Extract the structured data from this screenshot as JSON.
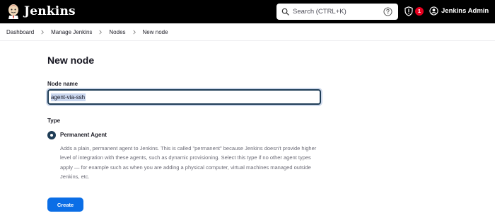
{
  "header": {
    "brand": "Jenkins",
    "search_placeholder": "Search (CTRL+K)",
    "notification_count": "1",
    "user_name": "Jenkins Admin"
  },
  "breadcrumb": [
    "Dashboard",
    "Manage Jenkins",
    "Nodes",
    "New node"
  ],
  "main": {
    "title": "New node",
    "node_name_label": "Node name",
    "node_name_value": "agent-via-ssh",
    "type_label": "Type",
    "type_option_label": "Permanent Agent",
    "type_option_description": "Adds a plain, permanent agent to Jenkins. This is called \"permanent\" because Jenkins doesn't provide higher level of integration with these agents, such as dynamic provisioning. Select this type if no other agent types apply — for example such as when you are adding a physical computer, virtual machines managed outside Jenkins, etc.",
    "create_label": "Create"
  },
  "colors": {
    "header_bg": "#000000",
    "primary_button": "#0b6ee6",
    "badge": "#e6001f",
    "radio_selected": "#1f3d57"
  }
}
